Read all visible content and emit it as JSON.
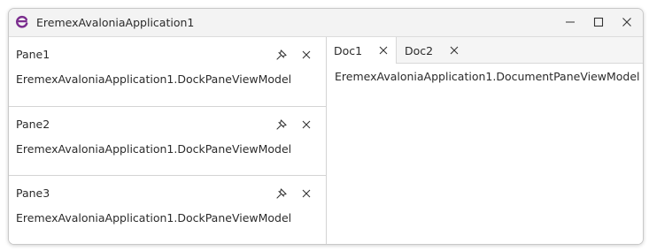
{
  "window": {
    "title": "EremexAvaloniaApplication1",
    "logo_icon": "eremex-logo-icon",
    "accent_color": "#7b2d8e",
    "controls": [
      "minimize-icon",
      "maximize-icon",
      "close-icon"
    ]
  },
  "panes": [
    {
      "title": "Pane1",
      "content": "EremexAvaloniaApplication1.DockPaneViewModel"
    },
    {
      "title": "Pane2",
      "content": "EremexAvaloniaApplication1.DockPaneViewModel"
    },
    {
      "title": "Pane3",
      "content": "EremexAvaloniaApplication1.DockPaneViewModel"
    }
  ],
  "pane_buttons": [
    "pin-icon",
    "close-icon"
  ],
  "documents": {
    "tabs": [
      {
        "label": "Doc1",
        "active": true
      },
      {
        "label": "Doc2",
        "active": false
      }
    ],
    "content": "EremexAvaloniaApplication1.DocumentPaneViewModel"
  }
}
